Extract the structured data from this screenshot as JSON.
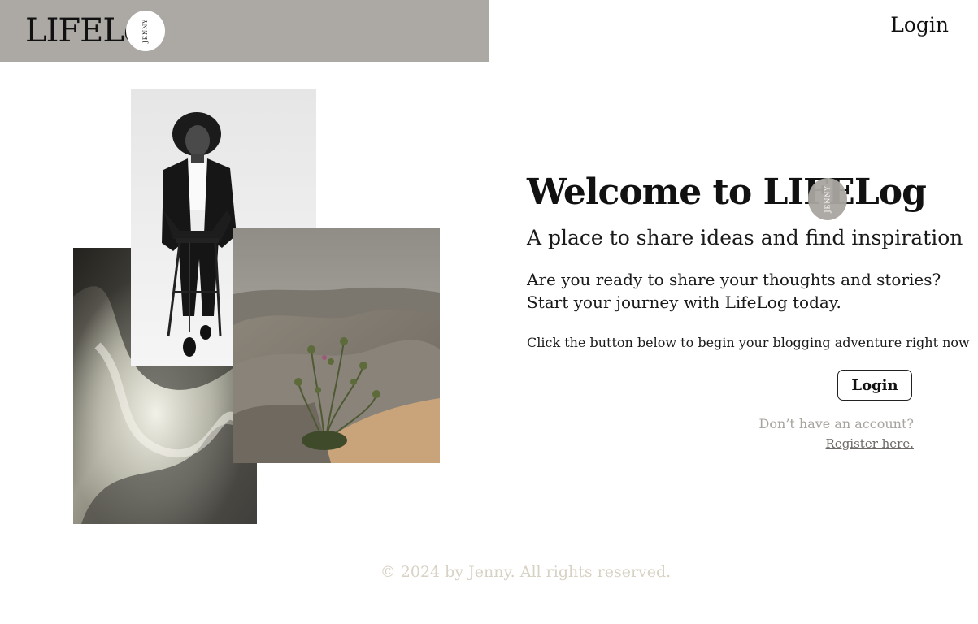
{
  "header": {
    "logo_text": "LIFELog",
    "logo_badge": "JENNY",
    "nav_login": "Login"
  },
  "hero": {
    "title": "Welcome to LIFELog",
    "title_badge": "JENNY",
    "subtitle": "A place to share ideas and find inspiration",
    "body_line1": "Are you ready to share your thoughts and stories?",
    "body_line2": "Start your journey with LifeLog today.",
    "cta_text": "Click the button below to begin your blogging adventure right now",
    "login_button": "Login",
    "no_account": "Don’t have an account?",
    "register_link": "Register here."
  },
  "footer": {
    "copyright": "© 2024 by Jenny. All rights reserved."
  },
  "colors": {
    "header_bg": "#aca9a4",
    "badge_bg": "#a9a6a1",
    "muted_text": "#a7a39d",
    "footer_text": "#d8d2c4"
  }
}
